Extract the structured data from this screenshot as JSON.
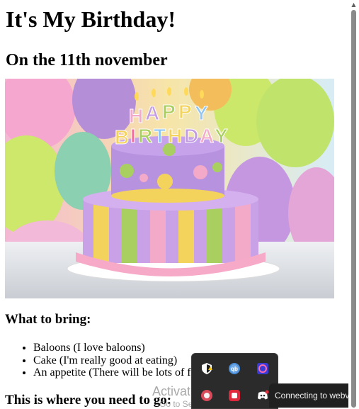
{
  "page": {
    "title": "It's My Birthday!",
    "date": "On the 11th november",
    "bring_heading": "What to bring:",
    "bring_items": [
      "Baloons (I love baloons)",
      "Cake (I'm really good at eating)",
      "An appetite (There will be lots of food)"
    ],
    "where_heading": "This is where you need to go:",
    "cake_topper_text": "HAPPY BIRTHDAY"
  },
  "overlay": {
    "watermark_line1": "Activate Windows",
    "watermark_line2": "Go to Settings to activate Windows.",
    "toast_text": "Connecting to webview..."
  },
  "colors": {
    "tray_bg": "#2b2b2b",
    "toast_bg": "#202020",
    "scroll_thumb": "#8a8a8a"
  },
  "icons": [
    "scroll-up-arrow-icon",
    "shield-warning-icon",
    "qbittorrent-icon",
    "app-icon",
    "antivirus-icon",
    "app-red-icon",
    "discord-icon"
  ]
}
